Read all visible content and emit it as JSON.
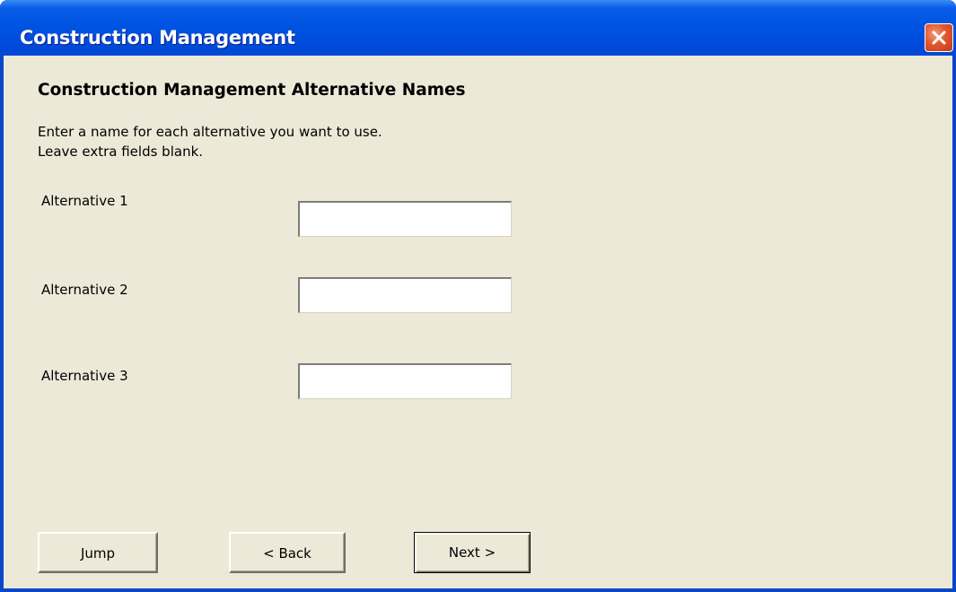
{
  "window": {
    "title": "Construction Management"
  },
  "dialog": {
    "heading": "Construction Management Alternative Names",
    "instructions": [
      "Enter a name for each alternative you want to use.",
      "Leave extra fields blank."
    ],
    "alternatives": [
      {
        "label": "Alternative 1",
        "value": ""
      },
      {
        "label": "Alternative 2",
        "value": ""
      },
      {
        "label": "Alternative 3",
        "value": ""
      }
    ]
  },
  "buttons": {
    "jump": "Jump",
    "back": "< Back",
    "next": "Next >"
  },
  "icons": {
    "close": "close-icon"
  },
  "colors": {
    "titlebar": "#0054e3",
    "client_bg": "#ece9d8",
    "close_button": "#e2562d"
  }
}
